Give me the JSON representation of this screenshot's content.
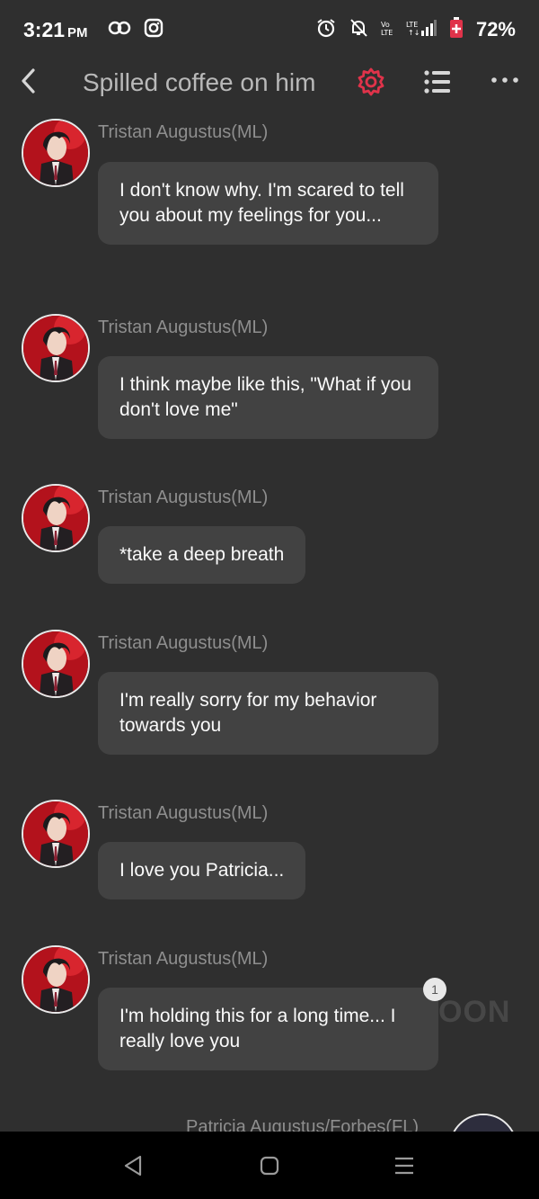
{
  "status_bar": {
    "time": "3:21",
    "ampm": "PM",
    "battery": "72%",
    "icons": [
      "link-icon",
      "instagram-icon",
      "alarm-icon",
      "mute-icon",
      "volte-icon",
      "lte-signal-icon",
      "battery-icon"
    ]
  },
  "header": {
    "title": "Spilled coffee on him",
    "accent_color": "#e0334a",
    "icons": [
      "back-arrow-icon",
      "gear-icon",
      "list-icon",
      "more-icon"
    ]
  },
  "messages": [
    {
      "sender": "Tristan Augustus(ML)",
      "text": "I don't know why. I'm scared to tell you about my feelings for you..."
    },
    {
      "sender": "Tristan Augustus(ML)",
      "text": "I think maybe like this, \"What if you don't love me\""
    },
    {
      "sender": "Tristan Augustus(ML)",
      "text": "*take a deep breath"
    },
    {
      "sender": "Tristan Augustus(ML)",
      "text": "I'm really sorry for my behavior towards you"
    },
    {
      "sender": "Tristan Augustus(ML)",
      "text": "I love you Patricia..."
    },
    {
      "sender": "Tristan Augustus(ML)",
      "text": "I'm holding this for a long time... I really love you",
      "badge": "1"
    }
  ],
  "partial_message": {
    "sender": "Patricia Augustus/Forbes(FL)"
  },
  "watermark": "OON",
  "nav_bar": {
    "icons": [
      "nav-back-icon",
      "nav-home-icon",
      "nav-recents-icon"
    ]
  }
}
